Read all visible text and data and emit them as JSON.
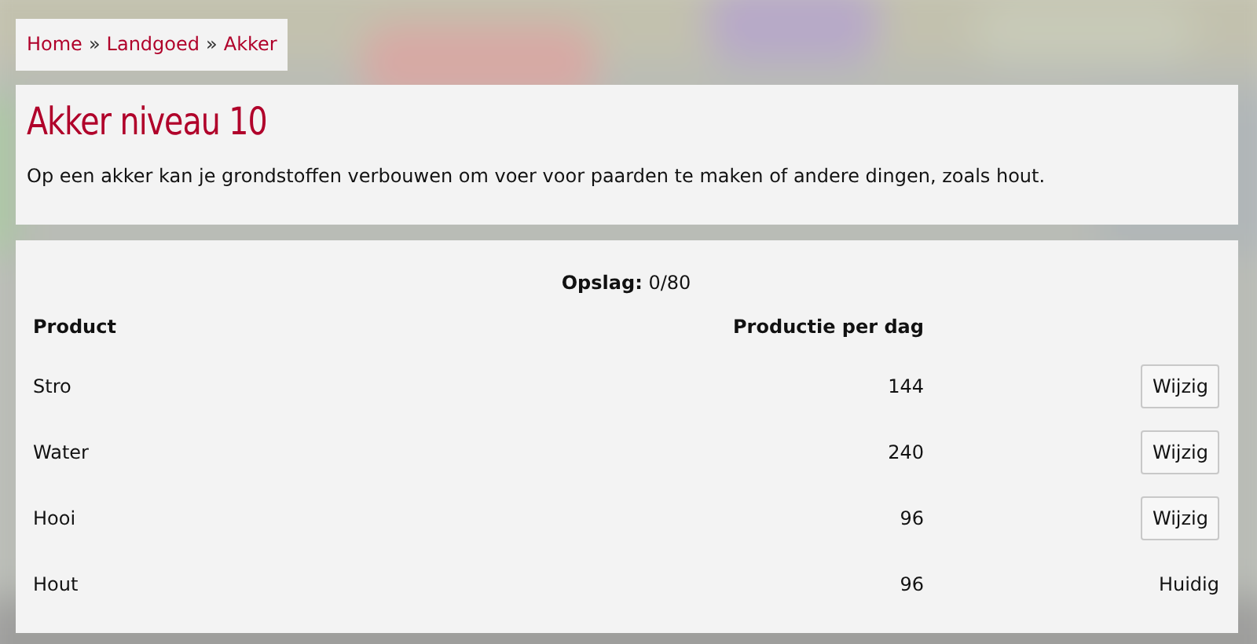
{
  "breadcrumb": {
    "separator": "»",
    "items": [
      "Home",
      "Landgoed",
      "Akker"
    ]
  },
  "header": {
    "title": "Akker niveau 10",
    "description": "Op een akker kan je grondstoffen verbouwen om voer voor paarden te maken of andere dingen, zoals hout."
  },
  "storage": {
    "label": "Opslag:",
    "value": "0/80"
  },
  "table": {
    "columns": [
      "Product",
      "Productie per dag"
    ],
    "rows": [
      {
        "product": "Stro",
        "production": "144",
        "action": {
          "kind": "button",
          "text": "Wijzig"
        }
      },
      {
        "product": "Water",
        "production": "240",
        "action": {
          "kind": "button",
          "text": "Wijzig"
        }
      },
      {
        "product": "Hooi",
        "production": "96",
        "action": {
          "kind": "button",
          "text": "Wijzig"
        }
      },
      {
        "product": "Hout",
        "production": "96",
        "action": {
          "kind": "current",
          "text": "Huidig"
        }
      }
    ]
  }
}
